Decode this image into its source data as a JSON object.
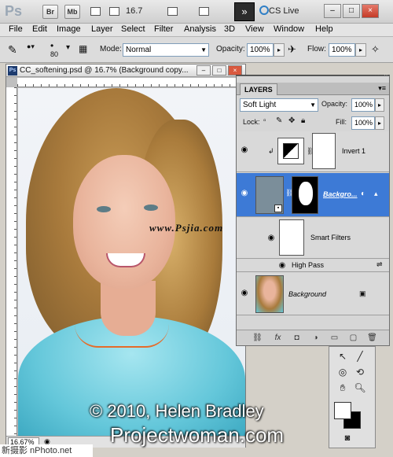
{
  "appbar": {
    "logo": "Ps",
    "bridge_button": "Br",
    "minibridge_button": "Mb",
    "zoom": "16.7",
    "cslive": "CS Live",
    "extras_icon": "fast-forward-icon"
  },
  "menu": [
    "File",
    "Edit",
    "Image",
    "Layer",
    "Select",
    "Filter",
    "Analysis",
    "3D",
    "View",
    "Window",
    "Help"
  ],
  "options": {
    "brush_size": "80",
    "mode_label": "Mode:",
    "mode_value": "Normal",
    "opacity_label": "Opacity:",
    "opacity_value": "100%",
    "flow_label": "Flow:",
    "flow_value": "100%"
  },
  "document": {
    "title": "CC_softening.psd @ 16.7% (Background copy...",
    "zoom": "16.67%"
  },
  "layers": {
    "tab": "LAYERS",
    "blend_mode": "Soft Light",
    "opacity_label": "Opacity:",
    "opacity_value": "100%",
    "lock_label": "Lock:",
    "fill_label": "Fill:",
    "fill_value": "100%",
    "rows": [
      {
        "name": "Invert 1"
      },
      {
        "name": "Backgro..."
      },
      {
        "name": "Smart Filters"
      },
      {
        "name": "High Pass"
      },
      {
        "name": "Background"
      }
    ]
  },
  "overlays": {
    "watermark": "www.Psjia.com",
    "credit_line1": "© 2010, Helen Bradley",
    "credit_line2": "Projectwoman.com",
    "site": "新摄影 nPhoto.net"
  },
  "colors": {
    "selection": "#3d7ad6",
    "canvas_bg": "#bfbfbf"
  }
}
